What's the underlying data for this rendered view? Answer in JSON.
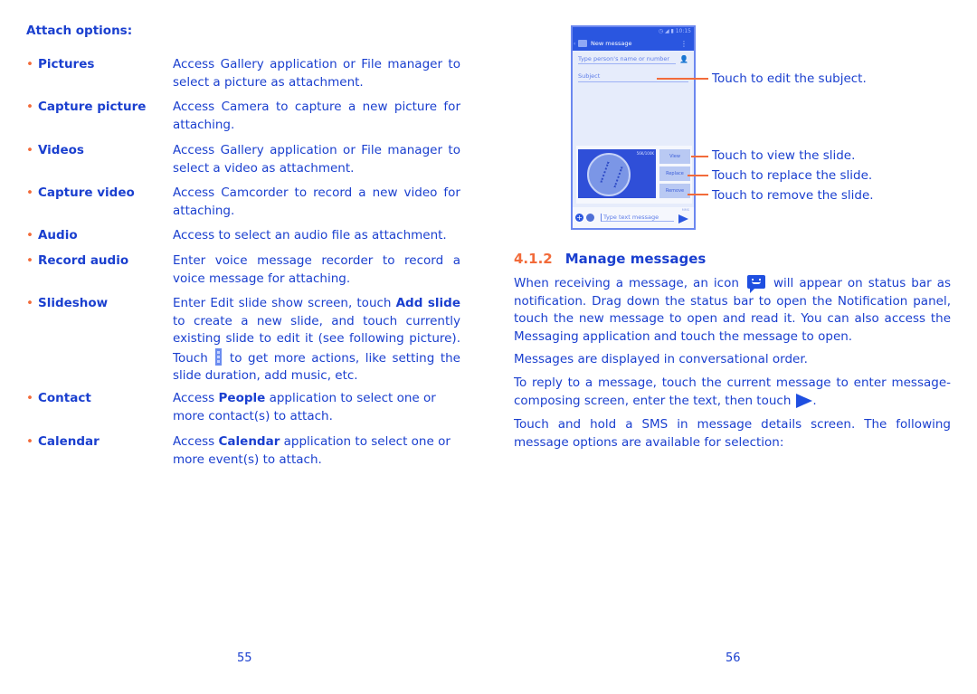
{
  "left_page": {
    "heading": "Attach options:",
    "options": [
      {
        "term": "Pictures",
        "desc": "Access Gallery application or File manager to select a picture as attachment."
      },
      {
        "term": "Capture picture",
        "desc": "Access Camera to capture a new picture for attaching."
      },
      {
        "term": "Videos",
        "desc": "Access Gallery application or File manager to select a video as attachment."
      },
      {
        "term": "Capture video",
        "desc": "Access Camcorder to record a new video for attaching."
      },
      {
        "term": "Audio",
        "desc": "Access to select an audio file as attachment."
      },
      {
        "term": "Record audio",
        "desc": "Enter voice message recorder to record a voice message for attaching."
      },
      {
        "term": "Slideshow",
        "desc_parts": [
          "Enter Edit slide show screen, touch ",
          "Add slide",
          " to create a new slide, and touch currently existing slide to edit it (see following picture). Touch ",
          " to get more actions, like setting the slide duration, add music, etc."
        ]
      },
      {
        "term": "Contact",
        "desc_parts": [
          "Access ",
          "People",
          " application to select one or more contact(s) to attach."
        ]
      },
      {
        "term": "Calendar",
        "desc_parts": [
          "Access ",
          "Calendar",
          " application to select one or more event(s) to attach."
        ]
      }
    ],
    "page_number": "55"
  },
  "right_page": {
    "phone": {
      "status_time": "10:15",
      "app_title": "New message",
      "to_placeholder": "Type person's name or number",
      "subject_placeholder": "Subject",
      "image_size": "56K/100K",
      "buttons": [
        "View",
        "Replace",
        "Remove"
      ],
      "message_placeholder": "Type text message",
      "mms_label": "MMS"
    },
    "callouts": [
      "Touch to edit the subject.",
      "Touch to view the slide.",
      "Touch to replace the slide.",
      "Touch to remove the slide."
    ],
    "section_number": "4.1.2",
    "section_title": "Manage messages",
    "para1_before": "When receiving a message, an icon",
    "para1_after": "will appear on status bar as notification. Drag down the status bar to open the Notification panel, touch the new message to open and read it. You can also access the Messaging application and touch the message to open.",
    "para2": "Messages are displayed in conversational order.",
    "para3_before": "To reply to a message, touch the current message to enter message-composing screen, enter the text, then touch",
    "para3_after": ".",
    "para4": "Touch and hold a SMS in message details screen. The following message options are available for selection:",
    "page_number": "56"
  },
  "colors": {
    "text": "#1a3fcf",
    "accent": "#f26b3a",
    "phone_bar": "#2a56e0"
  }
}
